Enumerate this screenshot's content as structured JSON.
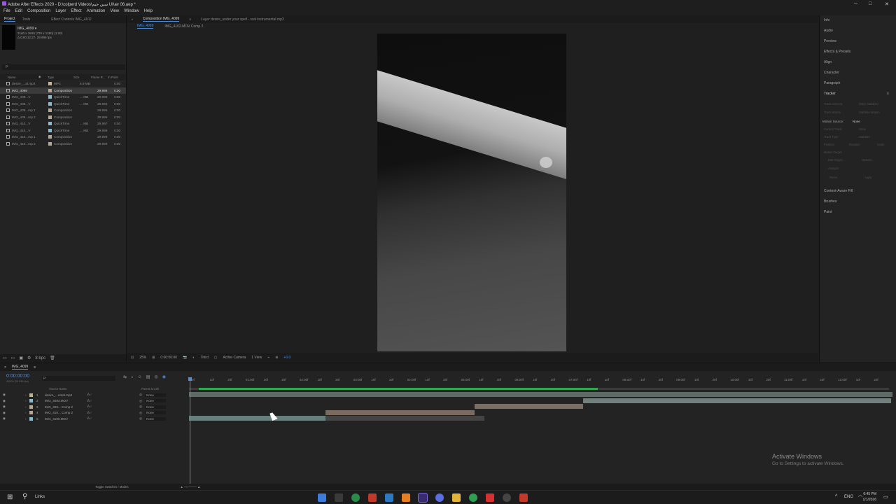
{
  "window": {
    "title": "Adobe After Effects 2020 - D:\\colperd Videos\\سين جيم UI\\av 06.aep *",
    "min_label": "─",
    "max_label": "□",
    "close_label": "✕"
  },
  "menu": [
    "File",
    "Edit",
    "Composition",
    "Layer",
    "Effect",
    "Animation",
    "View",
    "Window",
    "Help"
  ],
  "project": {
    "tabs": [
      "Project",
      "Tools"
    ],
    "effect_tab": "Effect Controls IMG_4102",
    "selected_name": "IMG_4099 ▾",
    "selected_res": "2160 x 3840  (720 x 1280) (1.00)",
    "selected_dur": "Δ 0;00;12;27, 29.996 fps",
    "search_placeholder": "ρ·",
    "columns": [
      "Name",
      "Type",
      "Size",
      "Frame R...",
      "In Point"
    ],
    "items": [
      {
        "name": "desire_...al.mp3",
        "type": "MP3",
        "size": "6.9 MB",
        "fps": "",
        "in": "0:00",
        "color": "#c6b48b",
        "sel": false
      },
      {
        "name": "IMG_4099",
        "type": "Composition",
        "size": "",
        "fps": "29.996",
        "in": "0:00",
        "color": "#b6a890",
        "sel": true
      },
      {
        "name": "IMG_409...V",
        "type": "QuickTime",
        "size": "... MB",
        "fps": "29.998",
        "in": "0:00",
        "color": "#8fb8c9",
        "sel": false
      },
      {
        "name": "IMG_409...V",
        "type": "QuickTime",
        "size": "... MB",
        "fps": "29.996",
        "in": "0:00",
        "color": "#8fb8c9",
        "sel": false
      },
      {
        "name": "IMG_409...mp 1",
        "type": "Composition",
        "size": "",
        "fps": "29.996",
        "in": "0:00",
        "color": "#b6a890",
        "sel": false
      },
      {
        "name": "IMG_409...mp 2",
        "type": "Composition",
        "size": "",
        "fps": "29.996",
        "in": "0:00",
        "color": "#b6a890",
        "sel": false
      },
      {
        "name": "IMG_410...V",
        "type": "QuickTime",
        "size": "... MB",
        "fps": "29.997",
        "in": "0:00",
        "color": "#8fb8c9",
        "sel": false
      },
      {
        "name": "IMG_410...V",
        "type": "QuickTime",
        "size": "... MB",
        "fps": "29.998",
        "in": "0:00",
        "color": "#8fb8c9",
        "sel": false
      },
      {
        "name": "IMG_410...mp 1",
        "type": "Composition",
        "size": "",
        "fps": "29.998",
        "in": "0:00",
        "color": "#b6a890",
        "sel": false
      },
      {
        "name": "IMG_410...mp 2",
        "type": "Composition",
        "size": "",
        "fps": "29.998",
        "in": "0:00",
        "color": "#b6a890",
        "sel": false
      }
    ],
    "bpc": "8 bpc"
  },
  "viewer": {
    "comp_tab": "Composition IMG_4099",
    "layer_tab": "Layer  desire_under your spell - real instrumental.mp3",
    "crumbs": [
      "IMG_4099",
      "IMG_4102.MOV Comp 2"
    ],
    "zoom": "25%",
    "time": "0:00:00:00",
    "resolution": "Third",
    "camera": "Active Camera",
    "views": "1 View",
    "exposure": "+0.0"
  },
  "panels": [
    "Info",
    "Audio",
    "Preview",
    "Effects & Presets",
    "Align",
    "Character",
    "Paragraph",
    "Tracker"
  ],
  "tracker": {
    "buttons": [
      "Track Camera",
      "Warp Stabilizer",
      "Track Motion",
      "Stabilize Motion"
    ],
    "motion_source_label": "Motion Source:",
    "motion_source": "None",
    "current_track_label": "Current Track:",
    "current_track": "None",
    "track_type_label": "Track Type:",
    "track_type": "Stabilize",
    "checks": [
      "Position",
      "Rotation",
      "Scale"
    ],
    "motion_target_label": "Motion Target:",
    "edit_target": "Edit Target...",
    "options": "Options...",
    "analyze_label": "Analyze:",
    "reset": "Reset",
    "apply": "Apply"
  },
  "panels2": [
    "Content-Aware Fill",
    "Brushes",
    "Paint"
  ],
  "timeline": {
    "tab": "IMG_4099",
    "timecode": "0:00:00:00",
    "fps_sub": "00000 (29.996 fps)",
    "col_source": "Source Name",
    "col_parent": "Parent & Link",
    "ruler": [
      "0f",
      "10f",
      "20f",
      "01:00f",
      "10f",
      "20f",
      "02:00f",
      "10f",
      "20f",
      "03:00f",
      "10f",
      "20f",
      "04:00f",
      "10f",
      "20f",
      "05:00f",
      "10f",
      "20f",
      "06:00f",
      "10f",
      "20f",
      "07:00f",
      "10f",
      "20f",
      "08:00f",
      "10f",
      "20f",
      "09:00f",
      "10f",
      "20f",
      "10:00f",
      "10f",
      "20f",
      "11:00f",
      "10f",
      "20f",
      "12:00f",
      "10f",
      "20f"
    ],
    "layers": [
      {
        "num": "1",
        "name": "desire_...ental.mp3",
        "color": "#b9b39a",
        "parent": "None"
      },
      {
        "num": "2",
        "name": "IMG_4093.MOV",
        "color": "#8fb8c9",
        "parent": "None"
      },
      {
        "num": "3",
        "name": "IMG_409... Comp 2",
        "color": "#b6a890",
        "parent": "None"
      },
      {
        "num": "4",
        "name": "IMG_410... Comp 2",
        "color": "#b6a890",
        "parent": "None"
      },
      {
        "num": "5",
        "name": "IMG_4100.MOV",
        "color": "#8fb8c9",
        "parent": "None"
      }
    ],
    "toggle": "Toggle Switches / Modes"
  },
  "watermark": {
    "title": "Activate Windows",
    "sub": "Go to Settings to activate Windows."
  },
  "taskbar": {
    "search": "Links",
    "lang": "ENG",
    "time": "6:45 PM",
    "date": "1/1/2026"
  }
}
